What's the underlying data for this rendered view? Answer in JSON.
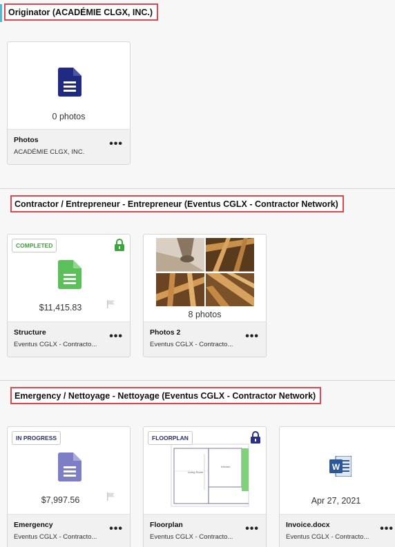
{
  "sections": [
    {
      "title": "Originator (ACADÉMIE CLGX, INC.)",
      "cards": [
        {
          "type": "photos",
          "caption": "0 photos",
          "name": "Photos",
          "subtitle": "ACADÉMIE CLGX, INC.",
          "icon": "document-icon",
          "icon_color": "#1f2a80"
        }
      ]
    },
    {
      "title": "Contractor / Entrepreneur - Entrepreneur (Eventus CGLX - Contractor Network)",
      "cards": [
        {
          "type": "estimate",
          "badge": "COMPLETED",
          "caption": "$11,415.83",
          "name": "Structure",
          "subtitle": "Eventus CGLX - Contracto...",
          "icon": "document-icon",
          "icon_color": "#5cc05a",
          "locked": true,
          "lock_color": "#3aa53a"
        },
        {
          "type": "photos",
          "caption": "8 photos",
          "name": "Photos 2",
          "subtitle": "Eventus CGLX - Contracto..."
        }
      ]
    },
    {
      "title": "Emergency / Nettoyage - Nettoyage (Eventus CGLX - Contractor Network)",
      "cards": [
        {
          "type": "estimate",
          "badge": "IN PROGRESS",
          "caption": "$7,997.56",
          "name": "Emergency",
          "subtitle": "Eventus CGLX - Contracto...",
          "icon": "document-icon",
          "icon_color": "#7e7ec7"
        },
        {
          "type": "floorplan",
          "badge": "FLOORPLAN",
          "name": "Floorplan",
          "subtitle": "Eventus CGLX - Contracto...",
          "locked": true,
          "lock_color": "#2a2f8a",
          "floorplan_labels": [
            "Living Room",
            "Kitchen"
          ]
        },
        {
          "type": "document",
          "caption": "Apr 27, 2021",
          "name": "Invoice.docx",
          "subtitle": "Eventus CGLX - Contracto...",
          "icon": "word-icon",
          "icon_color": "#2b579a"
        }
      ]
    }
  ],
  "colors": {
    "highlight_border": "#e0474c",
    "accent": "#58b8c9"
  }
}
